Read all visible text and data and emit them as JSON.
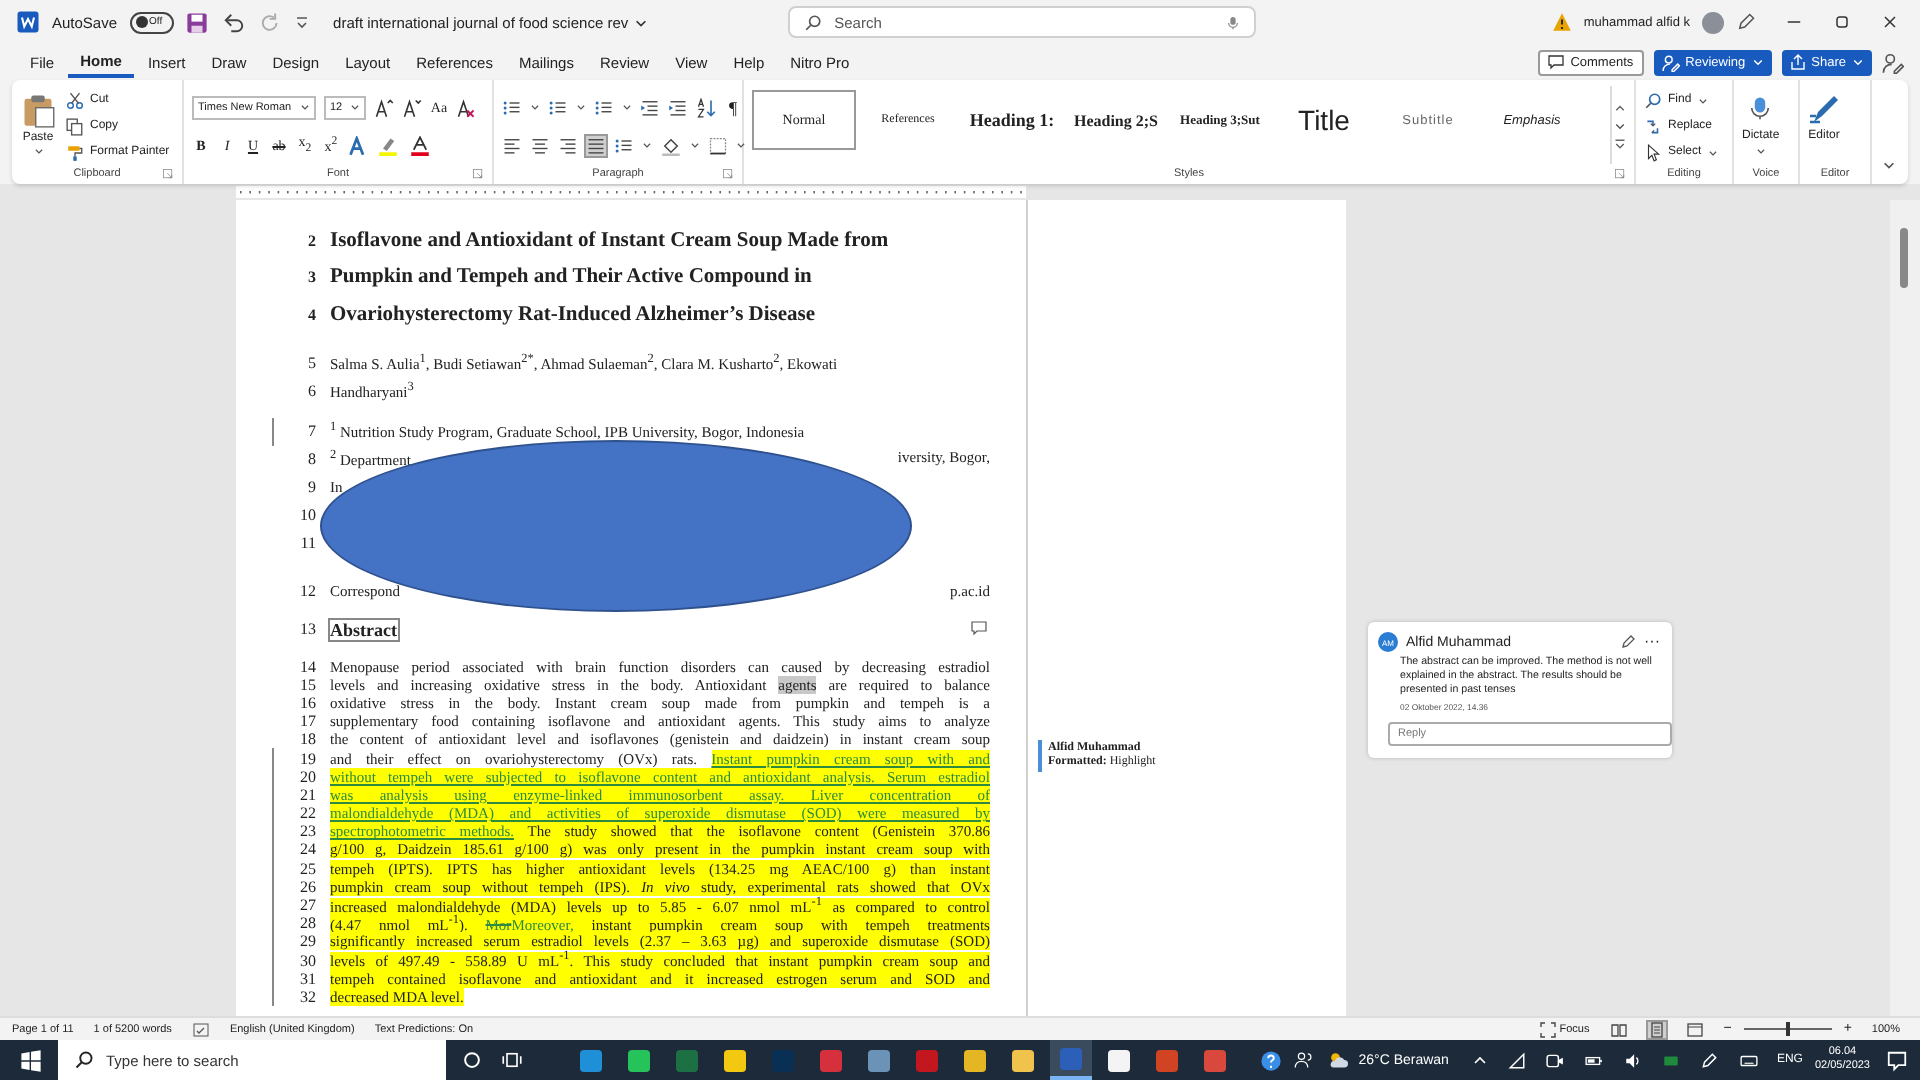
{
  "title_bar": {
    "autosave_label": "AutoSave",
    "autosave": {
      "label": "Off",
      "on": false
    },
    "document_title": "draft international journal of food science rev",
    "search": {
      "placeholder": "Search"
    },
    "user_name": "muhammad alfid k"
  },
  "ribbon_tabs": [
    {
      "label": "File",
      "selected": false
    },
    {
      "label": "Home",
      "selected": true
    },
    {
      "label": "Insert",
      "selected": false
    },
    {
      "label": "Draw",
      "selected": false
    },
    {
      "label": "Design",
      "selected": false
    },
    {
      "label": "Layout",
      "selected": false
    },
    {
      "label": "References",
      "selected": false
    },
    {
      "label": "Mailings",
      "selected": false
    },
    {
      "label": "Review",
      "selected": false
    },
    {
      "label": "View",
      "selected": false
    },
    {
      "label": "Help",
      "selected": false
    },
    {
      "label": "Nitro Pro",
      "selected": false
    }
  ],
  "ribbon_actions": {
    "comments": "Comments",
    "reviewing": "Reviewing",
    "share": "Share"
  },
  "clipboard": {
    "paste": "Paste",
    "cut": "Cut",
    "copy": "Copy",
    "format_painter": "Format Painter",
    "label": "Clipboard"
  },
  "font": {
    "name": "Times New Roman",
    "size": "12",
    "change_case": "Aa",
    "bold": "B",
    "italic": "I",
    "underline": "U",
    "strikethrough": "ab",
    "subscript": "x$_{2}$",
    "superscript": "x$^{2}$",
    "label": "Font"
  },
  "paragraph": {
    "pilcrow": "¶",
    "label": "Paragraph"
  },
  "styles": {
    "label": "Styles",
    "items": [
      {
        "label": "Normal",
        "kind": "normal",
        "selected": true
      },
      {
        "label": "References",
        "kind": "references",
        "selected": false
      },
      {
        "label": "Heading 1:",
        "kind": "heading1",
        "selected": false
      },
      {
        "label": "Heading 2;S",
        "kind": "heading2",
        "selected": false
      },
      {
        "label": "Heading 3;Sut",
        "kind": "heading3",
        "selected": false
      },
      {
        "label": "Title",
        "kind": "title",
        "selected": false
      },
      {
        "label": "Subtitle",
        "kind": "subtitle",
        "selected": false
      },
      {
        "label": "Emphasis",
        "kind": "emphasis",
        "selected": false
      }
    ]
  },
  "editing": {
    "find": "Find",
    "replace": "Replace",
    "select": "Select",
    "label": "Editing"
  },
  "voice": {
    "dictate": "Dictate",
    "label": "Voice"
  },
  "editor": {
    "button": "Editor",
    "label": "Editor"
  },
  "document": {
    "lines": [
      {
        "number": "2",
        "kind": "title",
        "changed": false,
        "text": "Isoflavone and Antioxidant of Instant Cream Soup Made from"
      },
      {
        "number": "3",
        "kind": "title",
        "changed": false,
        "text": "Pumpkin and Tempeh and Their Active Compound in"
      },
      {
        "number": "4",
        "kind": "title",
        "changed": false,
        "text": "Ovariohysterectomy Rat-Induced Alzheimer’s Disease"
      },
      {
        "number": "5",
        "kind": "author",
        "changed": false,
        "text": "Salma S. Aulia$^{1}$, Budi Setiawan$^{2*}$, Ahmad Sulaeman$^{2}$, Clara M. Kusharto$^{2}$, Ekowati"
      },
      {
        "number": "6",
        "kind": "author",
        "changed": false,
        "text": "Handharyani$^{3}$"
      },
      {
        "number": "7",
        "kind": "affiliation",
        "changed": true,
        "text": "$^{1}$ Nutrition Study Program, Graduate School, IPB University, Bogor, Indonesia"
      },
      {
        "number": "8",
        "kind": "affiliation",
        "changed": false,
        "text": "$^{2}$ Department",
        "text_right": "iversity, Bogor,"
      },
      {
        "number": "9",
        "kind": "affiliation",
        "changed": false,
        "text": "In"
      },
      {
        "number": "10",
        "kind": "affiliation",
        "changed": false
      },
      {
        "number": "11",
        "kind": "affiliation",
        "changed": false
      },
      {
        "number": "12",
        "kind": "correspondence",
        "changed": false,
        "text": "Correspond",
        "text_right": "p.ac.id"
      },
      {
        "number": "13",
        "kind": "heading",
        "changed": false,
        "text": "Abstract"
      },
      {
        "number": "14",
        "kind": "body",
        "changed": false,
        "segments": [
          {
            "text": "Menopause period associated with brain function disorders can caused by decreasing estradiol",
            "kind": "plain",
            "highlight": false
          }
        ]
      },
      {
        "number": "15",
        "kind": "body",
        "changed": false,
        "segments": [
          {
            "text": "levels and increasing oxidative stress in the body. Antioxidant ",
            "kind": "plain",
            "highlight": false
          },
          {
            "text": "agents",
            "kind": "anchor",
            "highlight": false
          },
          {
            "text": " are required to balance",
            "kind": "plain",
            "highlight": false
          }
        ]
      },
      {
        "number": "16",
        "kind": "body",
        "changed": false,
        "segments": [
          {
            "text": "oxidative stress in the body. Instant cream soup made from pumpkin and tempeh is a",
            "kind": "plain",
            "highlight": false
          }
        ]
      },
      {
        "number": "17",
        "kind": "body",
        "changed": false,
        "segments": [
          {
            "text": "supplementary food containing isoflavone and antioxidant agents. This study aims to analyze",
            "kind": "plain",
            "highlight": false
          }
        ]
      },
      {
        "number": "18",
        "kind": "body",
        "changed": false,
        "segments": [
          {
            "text": "the content of antioxidant level and isoflavones (genistein and daidzein) in instant cream soup",
            "kind": "plain",
            "highlight": false
          }
        ]
      },
      {
        "number": "19",
        "kind": "body",
        "changed": true,
        "segments": [
          {
            "text": "and their effect on ovariohysterectomy (OVx) rats. ",
            "kind": "plain",
            "highlight": false
          },
          {
            "text": "Instant pumpkin cream soup with and",
            "kind": "insert",
            "highlight": true
          }
        ]
      },
      {
        "number": "20",
        "kind": "body",
        "changed": true,
        "segments": [
          {
            "text": "without tempeh were subjected to isoflavone content and antioxidant analysis. Serum estradiol",
            "kind": "insert",
            "highlight": true
          }
        ]
      },
      {
        "number": "21",
        "kind": "body",
        "changed": true,
        "segments": [
          {
            "text": "was analysis using enzyme-linked immunosorbent assay. Liver concentration of",
            "kind": "insert",
            "highlight": true
          }
        ]
      },
      {
        "number": "22",
        "kind": "body",
        "changed": true,
        "segments": [
          {
            "text": "malondialdehyde (MDA) and activities of superoxide dismutase (SOD) were measured by",
            "kind": "insert",
            "highlight": true
          }
        ]
      },
      {
        "number": "23",
        "kind": "body",
        "changed": true,
        "segments": [
          {
            "text": "spectrophotometric methods.",
            "kind": "insert",
            "highlight": true
          },
          {
            "text": " The study showed that the isoflavone content (Genistein 370.86",
            "kind": "plain",
            "highlight": true
          }
        ]
      },
      {
        "number": "24",
        "kind": "body",
        "changed": true,
        "segments": [
          {
            "text": "g/100 g, Daidzein 185.61 g/100 g) was only present in the pumpkin instant cream soup with",
            "kind": "plain",
            "highlight": true
          }
        ]
      },
      {
        "number": "25",
        "kind": "body",
        "changed": true,
        "segments": [
          {
            "text": "tempeh (IPTS). IPTS has higher antioxidant levels (134.25 mg AEAC/100 g) than instant",
            "kind": "plain",
            "highlight": true
          }
        ]
      },
      {
        "number": "26",
        "kind": "body",
        "changed": true,
        "segments": [
          {
            "text": "pumpkin cream soup without tempeh (IPS). *In vivo* study, experimental rats showed that OVx",
            "kind": "plain",
            "highlight": true
          }
        ]
      },
      {
        "number": "27",
        "kind": "body",
        "changed": true,
        "segments": [
          {
            "text": "increased malondialdehyde (MDA) levels up to 5.85 - 6.07 nmol mL$^{-1}$ as compared to control",
            "kind": "plain",
            "highlight": true
          }
        ]
      },
      {
        "number": "28",
        "kind": "body",
        "changed": true,
        "segments": [
          {
            "text": "(4.47 nmol mL$^{-1}$). ",
            "kind": "plain",
            "highlight": true
          },
          {
            "text": "Mor",
            "kind": "delete",
            "highlight": true
          },
          {
            "text": "Moreover,",
            "kind": "insert",
            "highlight": true
          },
          {
            "text": " instant pumpkin cream soup with tempeh treatments",
            "kind": "plain",
            "highlight": true
          }
        ]
      },
      {
        "number": "29",
        "kind": "body",
        "changed": true,
        "segments": [
          {
            "text": "significantly increased serum estradiol levels (2.37 – 3.63 µg) and superoxide dismutase (SOD)",
            "kind": "plain",
            "highlight": true
          }
        ]
      },
      {
        "number": "30",
        "kind": "body",
        "changed": true,
        "segments": [
          {
            "text": "levels of 497.49 - 558.89 U mL$^{-1}$. This study concluded that instant pumpkin cream soup and",
            "kind": "plain",
            "highlight": true
          }
        ]
      },
      {
        "number": "31",
        "kind": "body",
        "changed": true,
        "segments": [
          {
            "text": "tempeh contained isoflavone and antioxidant and it increased estrogen serum and SOD and",
            "kind": "plain",
            "highlight": true
          }
        ]
      },
      {
        "number": "32",
        "kind": "body_end",
        "changed": true,
        "segments": [
          {
            "text": "decreased MDA level.",
            "kind": "plain",
            "highlight": true
          }
        ]
      }
    ]
  },
  "markup": {
    "author": "Alfid Muhammad",
    "text": "**Formatted:** Highlight"
  },
  "comment": {
    "initials": "AM",
    "author": "Alfid Muhammad",
    "more": "···",
    "text": "The abstract can be improved. The method is not well explained in the abstract. The results should be presented in past tenses",
    "date": "02 Oktober 2022, 14.36",
    "reply": {
      "placeholder": "Reply"
    }
  },
  "status_bar": {
    "page": "Page 1 of 11",
    "words": "1 of 5200 words",
    "language": "English (United Kingdom)",
    "predictions": "Text Predictions: On",
    "focus": "Focus",
    "zoom": {
      "level": 0.5
    },
    "zoom_out": "−",
    "zoom_in": "+",
    "zoom_percent": "100%"
  },
  "taskbar": {
    "search": {
      "placeholder": "Type here to search"
    },
    "apps": [
      {
        "color": "#1f8fd8",
        "selected": false
      },
      {
        "color": "#25c35a",
        "selected": false
      },
      {
        "color": "#1d7044",
        "selected": false
      },
      {
        "color": "#f2c811",
        "selected": false
      },
      {
        "color": "#0a2f55",
        "selected": false
      },
      {
        "color": "#d6303c",
        "selected": false
      },
      {
        "color": "#6b93b8",
        "selected": false
      },
      {
        "color": "#c2171e",
        "selected": false
      },
      {
        "color": "#e5b623",
        "selected": false
      },
      {
        "color": "#f0c44c",
        "selected": false
      },
      {
        "color": "#2b5fb8",
        "selected": true
      },
      {
        "color": "#f4f4f4",
        "selected": false
      },
      {
        "color": "#d04423",
        "selected": false
      },
      {
        "color": "#d8483c",
        "selected": false
      }
    ],
    "weather": "26°C Berawan",
    "language": "ENG",
    "time": "06.04",
    "date": "02/05/2023"
  }
}
